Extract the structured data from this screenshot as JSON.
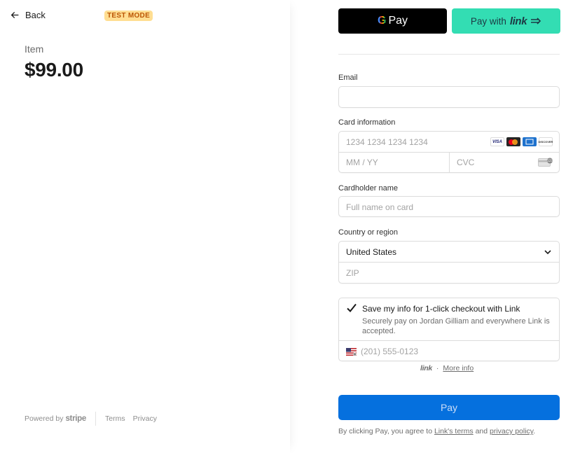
{
  "left": {
    "back_label": "Back",
    "test_mode_badge": "TEST MODE",
    "item_label": "Item",
    "item_price": "$99.00",
    "footer": {
      "powered_by": "Powered by",
      "stripe": "stripe",
      "terms": "Terms",
      "privacy": "Privacy"
    }
  },
  "wallets": {
    "gpay_g": "G",
    "gpay_text": "Pay",
    "link_prefix": "Pay with",
    "link_word": "link"
  },
  "form": {
    "email": {
      "label": "Email",
      "value": ""
    },
    "card": {
      "label": "Card information",
      "number_placeholder": "1234 1234 1234 1234",
      "expiry_placeholder": "MM / YY",
      "cvc_placeholder": "CVC",
      "brands": [
        "VISA",
        "Mastercard",
        "AMEX",
        "DISCOVER"
      ]
    },
    "cardholder": {
      "label": "Cardholder name",
      "placeholder": "Full name on card"
    },
    "country": {
      "label": "Country or region",
      "selected": "United States",
      "zip_placeholder": "ZIP"
    },
    "save_info": {
      "checked": true,
      "title": "Save my info for 1-click checkout with Link",
      "description": "Securely pay on Jordan Gilliam and everywhere Link is accepted.",
      "phone_placeholder": "(201) 555-0123"
    },
    "link_meta": {
      "word": "link",
      "separator": "·",
      "more_info": "More info"
    },
    "pay_label": "Pay",
    "terms": {
      "prefix": "By clicking Pay, you agree to ",
      "link_terms": "Link's terms",
      "and": " and ",
      "privacy": "privacy policy",
      "suffix": "."
    }
  },
  "colors": {
    "pay_button": "#0570de",
    "link_button": "#33ddb3",
    "badge_bg": "#ffde92",
    "badge_text": "#bb5504"
  }
}
